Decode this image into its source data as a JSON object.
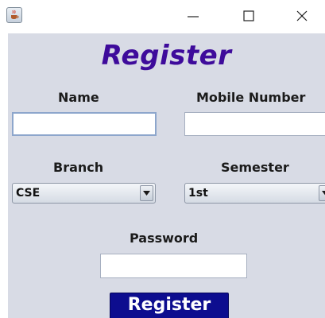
{
  "window": {
    "controls": {
      "minimize": "minimize-icon",
      "maximize": "maximize-icon",
      "close": "close-icon"
    },
    "app_icon": "java-cup-icon"
  },
  "form": {
    "title": "Register",
    "name_label": "Name",
    "name_value": "",
    "mobile_label": "Mobile Number",
    "mobile_value": "",
    "branch_label": "Branch",
    "branch_selected": "CSE",
    "semester_label": "Semester",
    "semester_selected": "1st",
    "password_label": "Password",
    "password_value": "",
    "submit_label": "Register"
  },
  "colors": {
    "background": "#d8dbe5",
    "title": "#3e0b9b",
    "submit_button": "#0d0d8f"
  }
}
